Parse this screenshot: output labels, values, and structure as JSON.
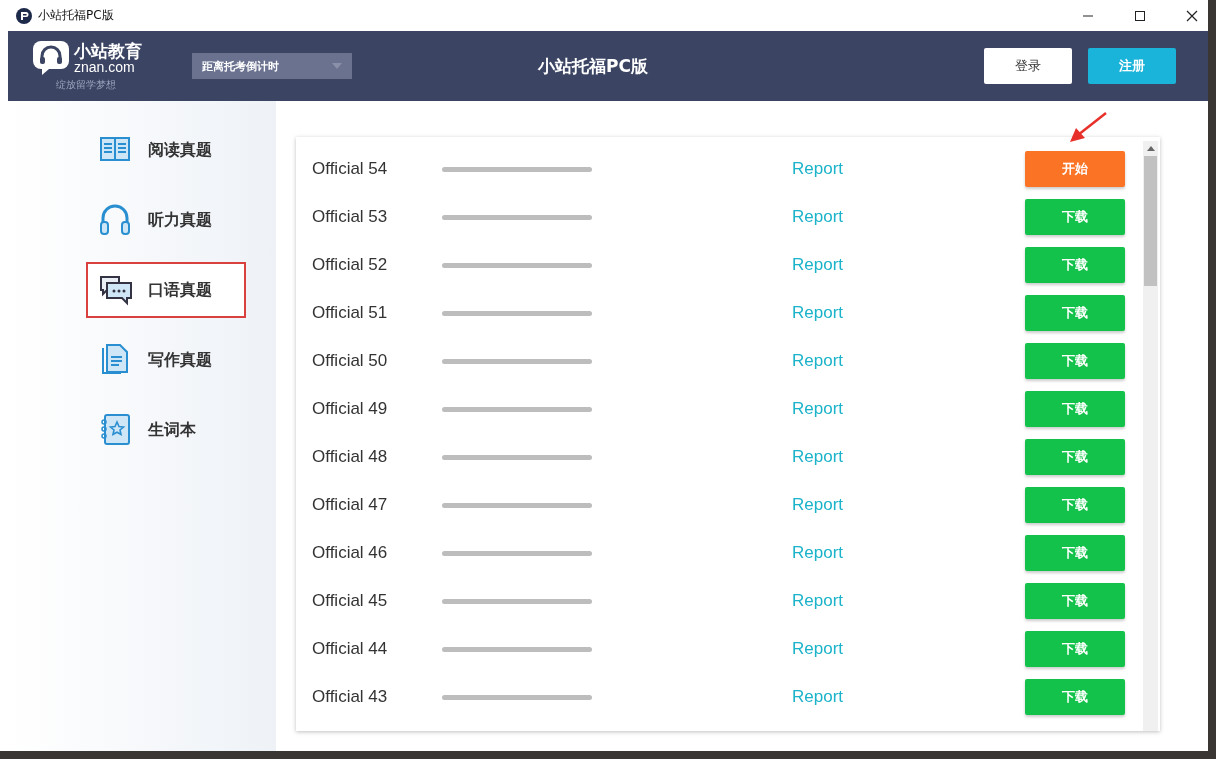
{
  "window": {
    "title": "小站托福PC版"
  },
  "header": {
    "logo": {
      "name": "小站教育",
      "domain": "znan.com",
      "slogan": "绽放留学梦想"
    },
    "countdown_dropdown": {
      "label": "距离托考倒计时"
    },
    "title": "小站托福PC版",
    "buttons": [
      {
        "label": "登录",
        "kind": "login"
      },
      {
        "label": "注册",
        "kind": "register"
      }
    ]
  },
  "sidebar": {
    "items": [
      {
        "label": "阅读真题",
        "selected": false
      },
      {
        "label": "听力真题",
        "selected": false
      },
      {
        "label": "口语真题",
        "selected": true
      },
      {
        "label": "写作真题",
        "selected": false
      },
      {
        "label": "生词本",
        "selected": false
      }
    ]
  },
  "tests": [
    {
      "name": "Official 54",
      "level": 0,
      "report": "Report",
      "action": "开始",
      "kind": "start"
    },
    {
      "name": "Official 53",
      "level": 0,
      "report": "Report",
      "action": "下载",
      "kind": "download"
    },
    {
      "name": "Official 52",
      "level": 0,
      "report": "Report",
      "action": "下载",
      "kind": "download"
    },
    {
      "name": "Official 51",
      "level": 0,
      "report": "Report",
      "action": "下载",
      "kind": "download"
    },
    {
      "name": "Official 50",
      "level": 0,
      "report": "Report",
      "action": "下载",
      "kind": "download"
    },
    {
      "name": "Official 49",
      "level": 0,
      "report": "Report",
      "action": "下载",
      "kind": "download"
    },
    {
      "name": "Official 48",
      "level": 0,
      "report": "Report",
      "action": "下载",
      "kind": "download"
    },
    {
      "name": "Official 47",
      "level": 0,
      "report": "Report",
      "action": "下载",
      "kind": "download"
    },
    {
      "name": "Official 46",
      "level": 0,
      "report": "Report",
      "action": "下载",
      "kind": "download"
    },
    {
      "name": "Official 45",
      "level": 0,
      "report": "Report",
      "action": "下载",
      "kind": "download"
    },
    {
      "name": "Official 44",
      "level": 0,
      "report": "Report",
      "action": "下载",
      "kind": "download"
    },
    {
      "name": "Official 43",
      "level": 0,
      "report": "Report",
      "action": "下载",
      "kind": "download"
    }
  ]
}
